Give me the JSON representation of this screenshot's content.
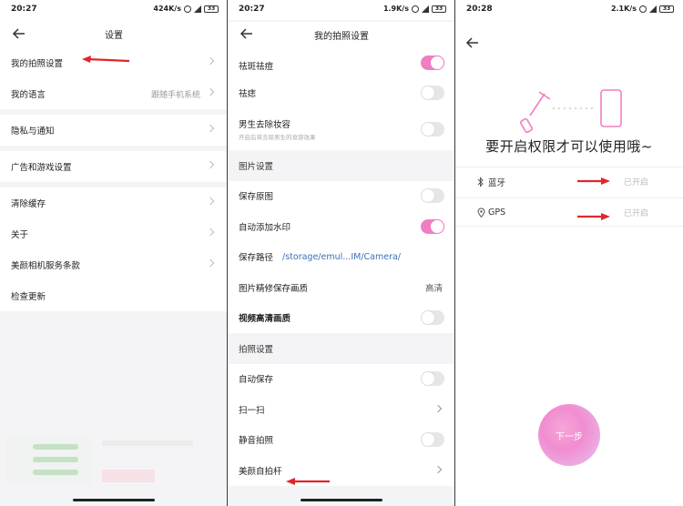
{
  "colors": {
    "accent": "#f07ec2",
    "arrow": "#e0262b",
    "link": "#3a6fb5",
    "secondary_text": "#999999"
  },
  "panel1": {
    "status": {
      "time": "20:27",
      "speed": "424K/s",
      "battery": "33"
    },
    "header": {
      "title": "设置",
      "back_icon": "back-arrow-icon"
    },
    "items": [
      {
        "label": "我的拍照设置",
        "value": ""
      },
      {
        "label": "我的语言",
        "value": "跟随手机系统"
      },
      {
        "label": "隐私与通知",
        "value": ""
      },
      {
        "label": "广告和游戏设置",
        "value": ""
      },
      {
        "label": "清除缓存",
        "value": ""
      },
      {
        "label": "关于",
        "value": ""
      },
      {
        "label": "美颜相机服务条款",
        "value": ""
      },
      {
        "label": "检查更新",
        "value": ""
      }
    ]
  },
  "panel2": {
    "status": {
      "time": "20:27",
      "speed": "1.9K/s",
      "battery": "33"
    },
    "header": {
      "title": "我的拍照设置"
    },
    "rows": [
      {
        "label": "祛斑祛痘",
        "toggle": true
      },
      {
        "label": "祛痣",
        "toggle": false
      },
      {
        "label": "男生去除妆容",
        "sub": "开启后将去除男生的妆容效果",
        "toggle": false
      },
      {
        "section": "图片设置"
      },
      {
        "label": "保存原图",
        "toggle": false
      },
      {
        "label": "自动添加水印",
        "toggle": true
      },
      {
        "label": "保存路径",
        "path": "/storage/emul...IM/Camera/"
      },
      {
        "label": "图片精修保存画质",
        "value": "高清"
      },
      {
        "label": "视频高清画质",
        "toggle": false
      },
      {
        "section": "拍照设置"
      },
      {
        "label": "自动保存",
        "toggle": false
      },
      {
        "label": "扫一扫",
        "chevron": true
      },
      {
        "label": "静音拍照",
        "toggle": false
      },
      {
        "label": "美颜自拍杆",
        "chevron": true
      }
    ]
  },
  "panel3": {
    "status": {
      "time": "20:28",
      "speed": "2.1K/s",
      "battery": "33"
    },
    "title": "要开启权限才可以使用哦~",
    "permissions": [
      {
        "label": "蓝牙",
        "status": "已开启",
        "icon": "bluetooth-icon"
      },
      {
        "label": "GPS",
        "status": "已开启",
        "icon": "location-pin-icon"
      }
    ],
    "next_button": "下一步"
  }
}
